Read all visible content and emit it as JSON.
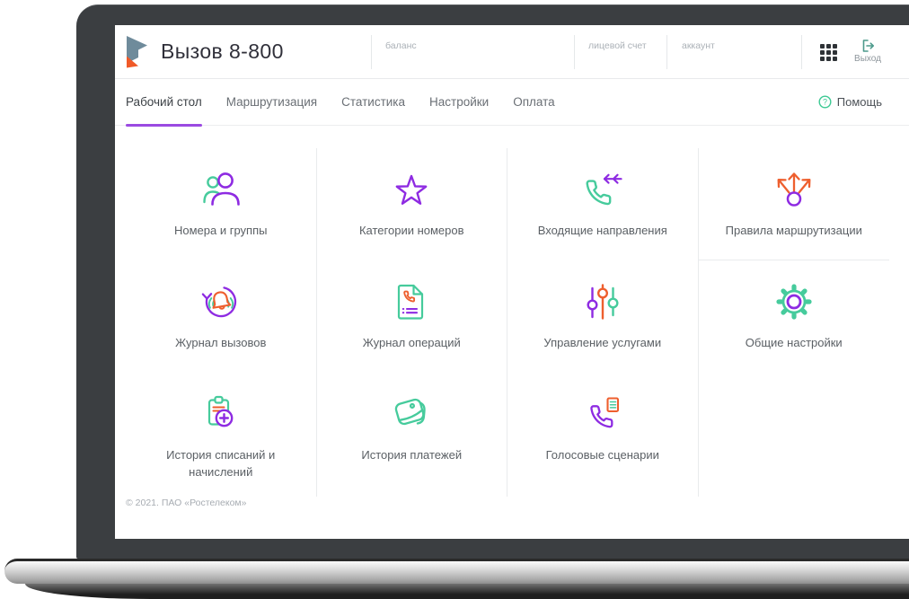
{
  "app": {
    "name": "Вызов 8-800",
    "footer_copyright": "© 2021. ПАО «Ростелеком»"
  },
  "header": {
    "account_fields": [
      {
        "label": "баланс"
      },
      {
        "label": "лицевой счет"
      },
      {
        "label": "аккаунт"
      }
    ],
    "exit": {
      "label": "Выход",
      "icon": "logout-icon"
    },
    "apps_icon": "apps-grid-icon"
  },
  "nav": {
    "tabs": [
      {
        "label": "Рабочий стол",
        "active": true
      },
      {
        "label": "Маршрутизация",
        "active": false
      },
      {
        "label": "Статистика",
        "active": false
      },
      {
        "label": "Настройки",
        "active": false
      },
      {
        "label": "Оплата",
        "active": false
      }
    ],
    "help": {
      "label": "Помощь",
      "icon": "question-circle-icon"
    }
  },
  "tiles": [
    {
      "label": "Номера и группы",
      "icon": "users-icon"
    },
    {
      "label": "Категории номеров",
      "icon": "star-icon"
    },
    {
      "label": "Входящие направления",
      "icon": "incoming-call-icon"
    },
    {
      "label": "Правила маршрутизации",
      "icon": "routing-arrows-icon"
    },
    {
      "label": "Журнал вызовов",
      "icon": "call-log-bell-icon"
    },
    {
      "label": "Журнал операций",
      "icon": "operations-document-icon"
    },
    {
      "label": "Управление услугами",
      "icon": "sliders-icon"
    },
    {
      "label": "Общие настройки",
      "icon": "settings-gear-icon"
    },
    {
      "label": "История списаний и начислений",
      "icon": "clipboard-plus-icon"
    },
    {
      "label": "История платежей",
      "icon": "wallet-icon"
    },
    {
      "label": "Голосовые сценарии",
      "icon": "voice-script-phone-icon"
    }
  ],
  "colors": {
    "accent_purple": "#8e2be2",
    "accent_green": "#46cb9c",
    "accent_orange": "#ee5f2e",
    "tab_underline": "#9b4ae1",
    "exit_teal": "#4d9a8c",
    "help_green": "#3cc993",
    "logo_slate": "#6f8b9b",
    "logo_orange": "#f05a28"
  }
}
